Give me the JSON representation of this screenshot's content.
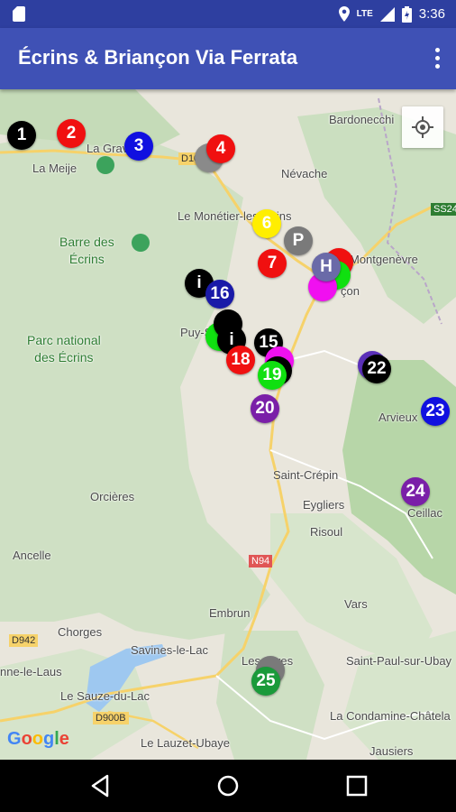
{
  "status": {
    "lte": "LTE",
    "time": "3:36"
  },
  "app": {
    "title": "Écrins & Briançon Via Ferrata"
  },
  "map": {
    "labels": [
      {
        "id": "bardonecchia",
        "text": "Bardonecchi"
      },
      {
        "id": "la-grave",
        "text": "La Grave"
      },
      {
        "id": "la-meije",
        "text": "La Meije"
      },
      {
        "id": "nevache",
        "text": "Névache"
      },
      {
        "id": "monetier",
        "text": "Le Monétier-les-Bains"
      },
      {
        "id": "montgenevre",
        "text": "Montgenèvre"
      },
      {
        "id": "briancon",
        "text": "çon"
      },
      {
        "id": "puy",
        "text": "Puy-Sai"
      },
      {
        "id": "arvieux",
        "text": "Arvieux"
      },
      {
        "id": "saint-crepin",
        "text": "Saint-Crépin"
      },
      {
        "id": "eygliers",
        "text": "Eygliers"
      },
      {
        "id": "risoul",
        "text": "Risoul"
      },
      {
        "id": "ceillac",
        "text": "Ceillac"
      },
      {
        "id": "orcieres",
        "text": "Orcières"
      },
      {
        "id": "ancelle",
        "text": "Ancelle"
      },
      {
        "id": "embrun",
        "text": "Embrun"
      },
      {
        "id": "vars",
        "text": "Vars"
      },
      {
        "id": "chorges",
        "text": "Chorges"
      },
      {
        "id": "savines",
        "text": "Savines-le-Lac"
      },
      {
        "id": "les-orres",
        "text": "Les Orres"
      },
      {
        "id": "saint-paul",
        "text": "Saint-Paul-sur-Ubay"
      },
      {
        "id": "laus",
        "text": "nne-le-Laus"
      },
      {
        "id": "sauze",
        "text": "Le Sauze-du-Lac"
      },
      {
        "id": "condamine",
        "text": "La Condamine-Châtela"
      },
      {
        "id": "lauzet",
        "text": "Le Lauzet-Ubaye"
      },
      {
        "id": "jausiers",
        "text": "Jausiers"
      }
    ],
    "parks": [
      {
        "id": "barre",
        "line1": "Barre des",
        "line2": "Écrins"
      },
      {
        "id": "parc",
        "line1": "Parc national",
        "line2": "des Écrins"
      }
    ],
    "road_shields": [
      "D1091",
      "SS24",
      "N94",
      "D942",
      "D900B"
    ],
    "markers": [
      {
        "id": "1",
        "text": "1",
        "color": "#000000"
      },
      {
        "id": "2",
        "text": "2",
        "color": "#f01010"
      },
      {
        "id": "3",
        "text": "3",
        "color": "#1010e0"
      },
      {
        "id": "4",
        "text": "4",
        "color": "#f01010"
      },
      {
        "id": "6",
        "text": "6",
        "color": "#ffee00"
      },
      {
        "id": "P",
        "text": "P",
        "color": "#7a7a7a"
      },
      {
        "id": "7",
        "text": "7",
        "color": "#f01010"
      },
      {
        "id": "H",
        "text": "H",
        "color": "#6a6aa8"
      },
      {
        "id": "i1",
        "text": "i",
        "color": "#000000"
      },
      {
        "id": "16",
        "text": "16",
        "color": "#1a1aa8"
      },
      {
        "id": "i2",
        "text": "i",
        "color": "#000000"
      },
      {
        "id": "15",
        "text": "15",
        "color": "#000000"
      },
      {
        "id": "18",
        "text": "18",
        "color": "#f01010"
      },
      {
        "id": "19",
        "text": "19",
        "color": "#10e010"
      },
      {
        "id": "20",
        "text": "20",
        "color": "#7a1fa8"
      },
      {
        "id": "22",
        "text": "22",
        "color": "#000000"
      },
      {
        "id": "23",
        "text": "23",
        "color": "#1010e0"
      },
      {
        "id": "24",
        "text": "24",
        "color": "#7a1fa8"
      },
      {
        "id": "25",
        "text": "25",
        "color": "#1a9a3a"
      }
    ]
  },
  "attribution": "Google"
}
